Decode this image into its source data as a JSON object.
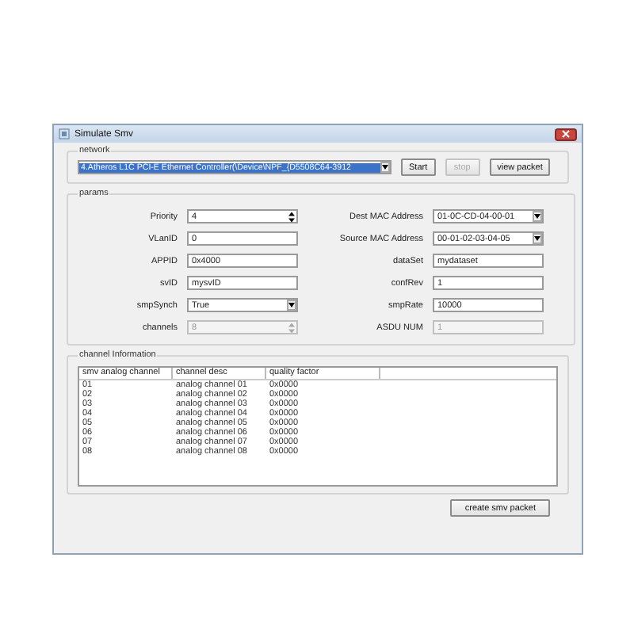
{
  "window": {
    "title": "Simulate Smv"
  },
  "network": {
    "label": "network",
    "adapter": "4.Atheros L1C PCI-E Ethernet Controller(\\Device\\NPF_{D5508C64-3912",
    "buttons": [
      {
        "label": "Start",
        "disabled": false
      },
      {
        "label": "stop",
        "disabled": true
      },
      {
        "label": "view  packet",
        "disabled": false
      }
    ]
  },
  "params": {
    "label": "params",
    "left": [
      {
        "label": "Priority",
        "kind": "spin",
        "value": "4",
        "disabled": false
      },
      {
        "label": "VLanID",
        "kind": "text",
        "value": "0",
        "disabled": false
      },
      {
        "label": "APPID",
        "kind": "text",
        "value": "0x4000",
        "disabled": false
      },
      {
        "label": "svID",
        "kind": "text",
        "value": "mysvID",
        "disabled": false
      },
      {
        "label": "smpSynch",
        "kind": "combo",
        "value": "True",
        "disabled": false
      },
      {
        "label": "channels",
        "kind": "spin",
        "value": "8",
        "disabled": true
      }
    ],
    "right": [
      {
        "label": "Dest MAC Address",
        "kind": "combo",
        "value": "01-0C-CD-04-00-01",
        "disabled": false
      },
      {
        "label": "Source MAC Address",
        "kind": "combo",
        "value": "00-01-02-03-04-05",
        "disabled": false
      },
      {
        "label": "dataSet",
        "kind": "text",
        "value": "mydataset",
        "disabled": false
      },
      {
        "label": "confRev",
        "kind": "text",
        "value": "1",
        "disabled": false
      },
      {
        "label": "smpRate",
        "kind": "text",
        "value": "10000",
        "disabled": false
      },
      {
        "label": "ASDU NUM",
        "kind": "text",
        "value": "1",
        "disabled": true
      }
    ]
  },
  "channels": {
    "label": "channel Information",
    "columns": [
      "smv analog channel",
      "channel desc",
      "quality factor"
    ],
    "rows": [
      [
        "01",
        "analog channel 01",
        "0x0000"
      ],
      [
        "02",
        "analog channel 02",
        "0x0000"
      ],
      [
        "03",
        "analog channel 03",
        "0x0000"
      ],
      [
        "04",
        "analog channel 04",
        "0x0000"
      ],
      [
        "05",
        "analog channel 05",
        "0x0000"
      ],
      [
        "06",
        "analog channel 06",
        "0x0000"
      ],
      [
        "07",
        "analog channel 07",
        "0x0000"
      ],
      [
        "08",
        "analog channel 08",
        "0x0000"
      ]
    ]
  },
  "create_button": "create smv packet"
}
